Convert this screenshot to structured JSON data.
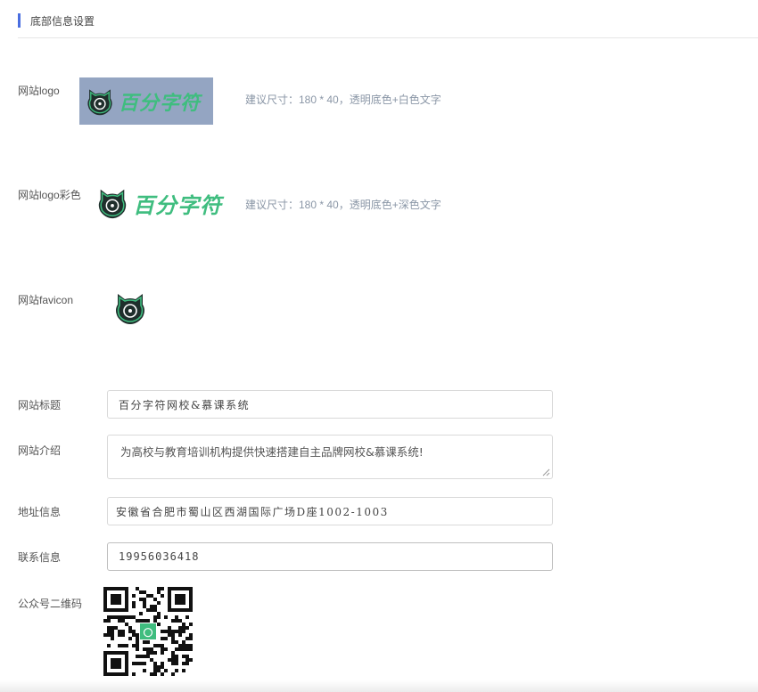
{
  "section": {
    "title": "底部信息设置"
  },
  "site_logo": {
    "label": "网站logo",
    "logo_text": "百分字符",
    "hint": "建议尺寸：180 * 40，透明底色+白色文字",
    "icon": "cat-face-icon"
  },
  "site_logo_color": {
    "label": "网站logo彩色",
    "logo_text": "百分字符",
    "hint": "建议尺寸：180 * 40，透明底色+深色文字",
    "icon": "cat-face-icon"
  },
  "favicon": {
    "label": "网站favicon",
    "icon": "cat-face-icon"
  },
  "site_title": {
    "label": "网站标题",
    "value": "百分字符网校&慕课系统"
  },
  "site_intro": {
    "label": "网站介绍",
    "value": "为高校与教育培训机构提供快速搭建自主品牌网校&慕课系统!"
  },
  "address": {
    "label": "地址信息",
    "value": "安徽省合肥市蜀山区西湖国际广场D座1002-1003"
  },
  "contact": {
    "label": "联系信息",
    "value": "19956036418"
  },
  "qrcode": {
    "label": "公众号二维码",
    "icon": "qr-code-icon"
  },
  "colors": {
    "accent": "#4a6ee0",
    "logo_green": "#3fbd7f",
    "logo_bg": "#94a5c2",
    "hint": "#8a96a6"
  }
}
